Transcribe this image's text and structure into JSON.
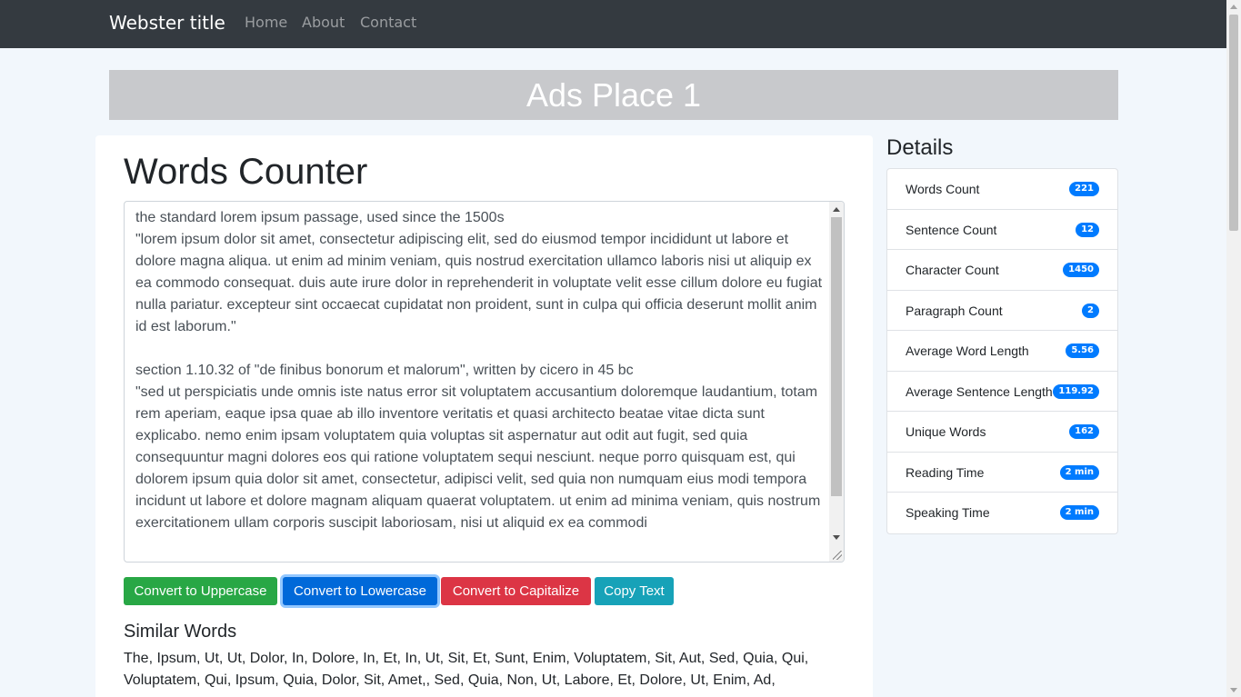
{
  "nav": {
    "brand": "Webster title",
    "links": [
      "Home",
      "About",
      "Contact"
    ]
  },
  "ads": {
    "label": "Ads Place 1"
  },
  "main": {
    "title": "Words Counter",
    "textarea_value": "the standard lorem ipsum passage, used since the 1500s\n\"lorem ipsum dolor sit amet, consectetur adipiscing elit, sed do eiusmod tempor incididunt ut labore et dolore magna aliqua. ut enim ad minim veniam, quis nostrud exercitation ullamco laboris nisi ut aliquip ex ea commodo consequat. duis aute irure dolor in reprehenderit in voluptate velit esse cillum dolore eu fugiat nulla pariatur. excepteur sint occaecat cupidatat non proident, sunt in culpa qui officia deserunt mollit anim id est laborum.\"\n\nsection 1.10.32 of \"de finibus bonorum et malorum\", written by cicero in 45 bc\n\"sed ut perspiciatis unde omnis iste natus error sit voluptatem accusantium doloremque laudantium, totam rem aperiam, eaque ipsa quae ab illo inventore veritatis et quasi architecto beatae vitae dicta sunt explicabo. nemo enim ipsam voluptatem quia voluptas sit aspernatur aut odit aut fugit, sed quia consequuntur magni dolores eos qui ratione voluptatem sequi nesciunt. neque porro quisquam est, qui dolorem ipsum quia dolor sit amet, consectetur, adipisci velit, sed quia non numquam eius modi tempora incidunt ut labore et dolore magnam aliquam quaerat voluptatem. ut enim ad minima veniam, quis nostrum exercitationem ullam corporis suscipit laboriosam, nisi ut aliquid ex ea commodi",
    "buttons": {
      "uppercase": "Convert to Uppercase",
      "lowercase": "Convert to Lowercase",
      "capitalize": "Convert to Capitalize",
      "copy": "Copy Text"
    },
    "similar_title": "Similar Words",
    "similar_text": "The, Ipsum, Ut, Ut, Dolor, In, Dolore, In, Et, In, Ut, Sit, Et, Sunt, Enim, Voluptatem, Sit, Aut, Sed, Quia, Qui, Voluptatem, Qui, Ipsum, Quia, Dolor, Sit, Amet,, Sed, Quia, Non, Ut, Labore, Et, Dolore, Ut, Enim, Ad,"
  },
  "details": {
    "title": "Details",
    "items": [
      {
        "label": "Words Count",
        "value": "221"
      },
      {
        "label": "Sentence Count",
        "value": "12"
      },
      {
        "label": "Character Count",
        "value": "1450"
      },
      {
        "label": "Paragraph Count",
        "value": "2"
      },
      {
        "label": "Average Word Length",
        "value": "5.56"
      },
      {
        "label": "Average Sentence Length",
        "value": "119.92"
      },
      {
        "label": "Unique Words",
        "value": "162"
      },
      {
        "label": "Reading Time",
        "value": "2 min"
      },
      {
        "label": "Speaking Time",
        "value": "2 min"
      }
    ]
  },
  "colors": {
    "navbar": "#343a40",
    "green": "#28a745",
    "blue": "#0069d9",
    "red": "#dc3545",
    "teal": "#17a2b8",
    "badge": "#007bff"
  }
}
